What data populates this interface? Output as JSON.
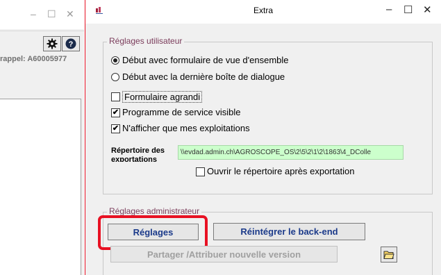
{
  "background_window": {
    "minimize_icon": "–",
    "maximize_icon": "☐",
    "close_icon": "✕",
    "rappel_text": "rappel: A60005977"
  },
  "dialog": {
    "title": "Extra",
    "minimize_icon": "–",
    "maximize_icon": "☐",
    "close_icon": "✕",
    "user_settings": {
      "legend": "Réglages utilisateur",
      "radio_overview": "Début avec formulaire de vue d'ensemble",
      "radio_last_dialog": "Début avec la dernière boîte de dialogue",
      "chk_enlarged": "Formulaire agrandi",
      "chk_service": "Programme de service visible",
      "chk_my_farms": "N'afficher que mes exploitations",
      "export_dir_label": "Répertoire des exportations",
      "export_dir_value": "\\\\evdad.admin.ch\\AGROSCOPE_OS\\2\\5\\2\\1\\2\\1863\\4_DColle",
      "chk_open_after": "Ouvrir le répertoire après exportation",
      "checked_mark": "✔"
    },
    "admin_settings": {
      "legend": "Réglages administrateur",
      "btn_settings": "Réglages",
      "btn_reintegrate": "Réintégrer le back-end",
      "btn_share": "Partager /Attribuer nouvelle version"
    }
  },
  "colors": {
    "highlight": "#e81123",
    "legend_text": "#7a3b5a",
    "path_bg": "#ccffcc",
    "button_text": "#1b3a8a"
  }
}
